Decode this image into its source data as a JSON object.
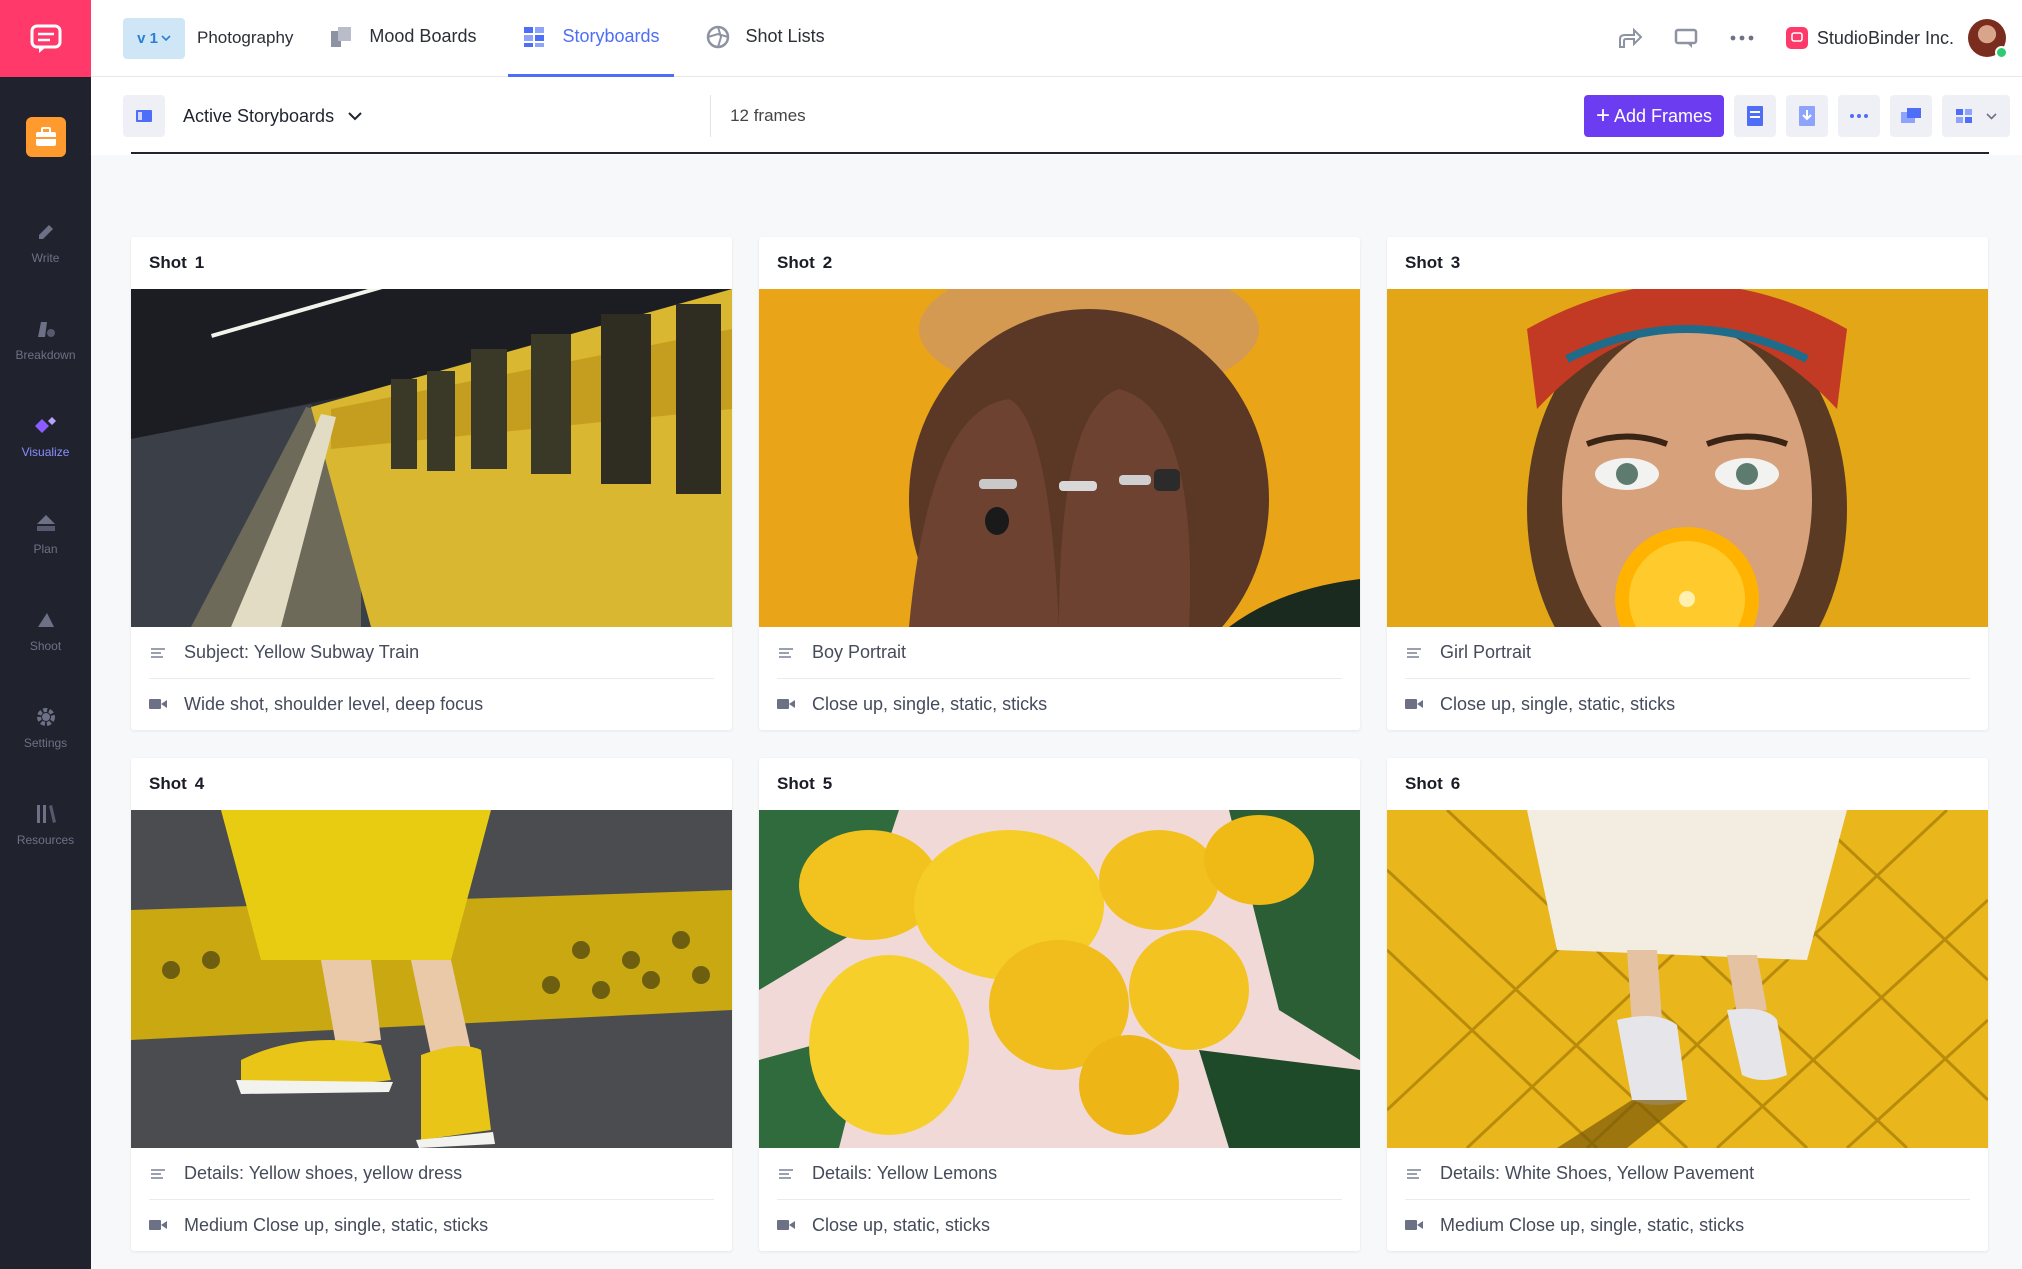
{
  "header": {
    "version": "v 1",
    "project": "Photography",
    "tabs": [
      {
        "label": "Mood Boards",
        "icon": "mood-boards-icon"
      },
      {
        "label": "Storyboards",
        "icon": "storyboards-icon"
      },
      {
        "label": "Shot Lists",
        "icon": "shot-lists-icon"
      }
    ],
    "company": "StudioBinder Inc."
  },
  "sidebar": {
    "items": [
      {
        "label": "Write",
        "icon": "pen-icon"
      },
      {
        "label": "Breakdown",
        "icon": "breakdown-icon"
      },
      {
        "label": "Visualize",
        "icon": "visualize-icon"
      },
      {
        "label": "Plan",
        "icon": "plan-icon"
      },
      {
        "label": "Shoot",
        "icon": "shoot-icon"
      },
      {
        "label": "Settings",
        "icon": "gear-icon"
      },
      {
        "label": "Resources",
        "icon": "resources-icon"
      }
    ]
  },
  "toolbar": {
    "view": "Active Storyboards",
    "frame_count": "12 frames",
    "add_frames": "Add Frames"
  },
  "colors": {
    "accent": "#4f6ef7",
    "primary_button": "#6c3cf0",
    "brand": "#ff3a6b"
  },
  "shots": [
    {
      "label": "Shot",
      "number": "1",
      "description": "Subject: Yellow Subway Train",
      "camera": "Wide shot, shoulder level, deep focus"
    },
    {
      "label": "Shot",
      "number": "2",
      "description": "Boy Portrait",
      "camera": "Close up, single, static, sticks"
    },
    {
      "label": "Shot",
      "number": "3",
      "description": "Girl Portrait",
      "camera": "Close up, single, static, sticks"
    },
    {
      "label": "Shot",
      "number": "4",
      "description": "Details: Yellow shoes, yellow dress",
      "camera": "Medium Close up, single, static, sticks"
    },
    {
      "label": "Shot",
      "number": "5",
      "description": "Details: Yellow Lemons",
      "camera": "Close up, static, sticks"
    },
    {
      "label": "Shot",
      "number": "6",
      "description": "Details: White Shoes, Yellow Pavement",
      "camera": "Medium Close up, single, static, sticks"
    }
  ]
}
